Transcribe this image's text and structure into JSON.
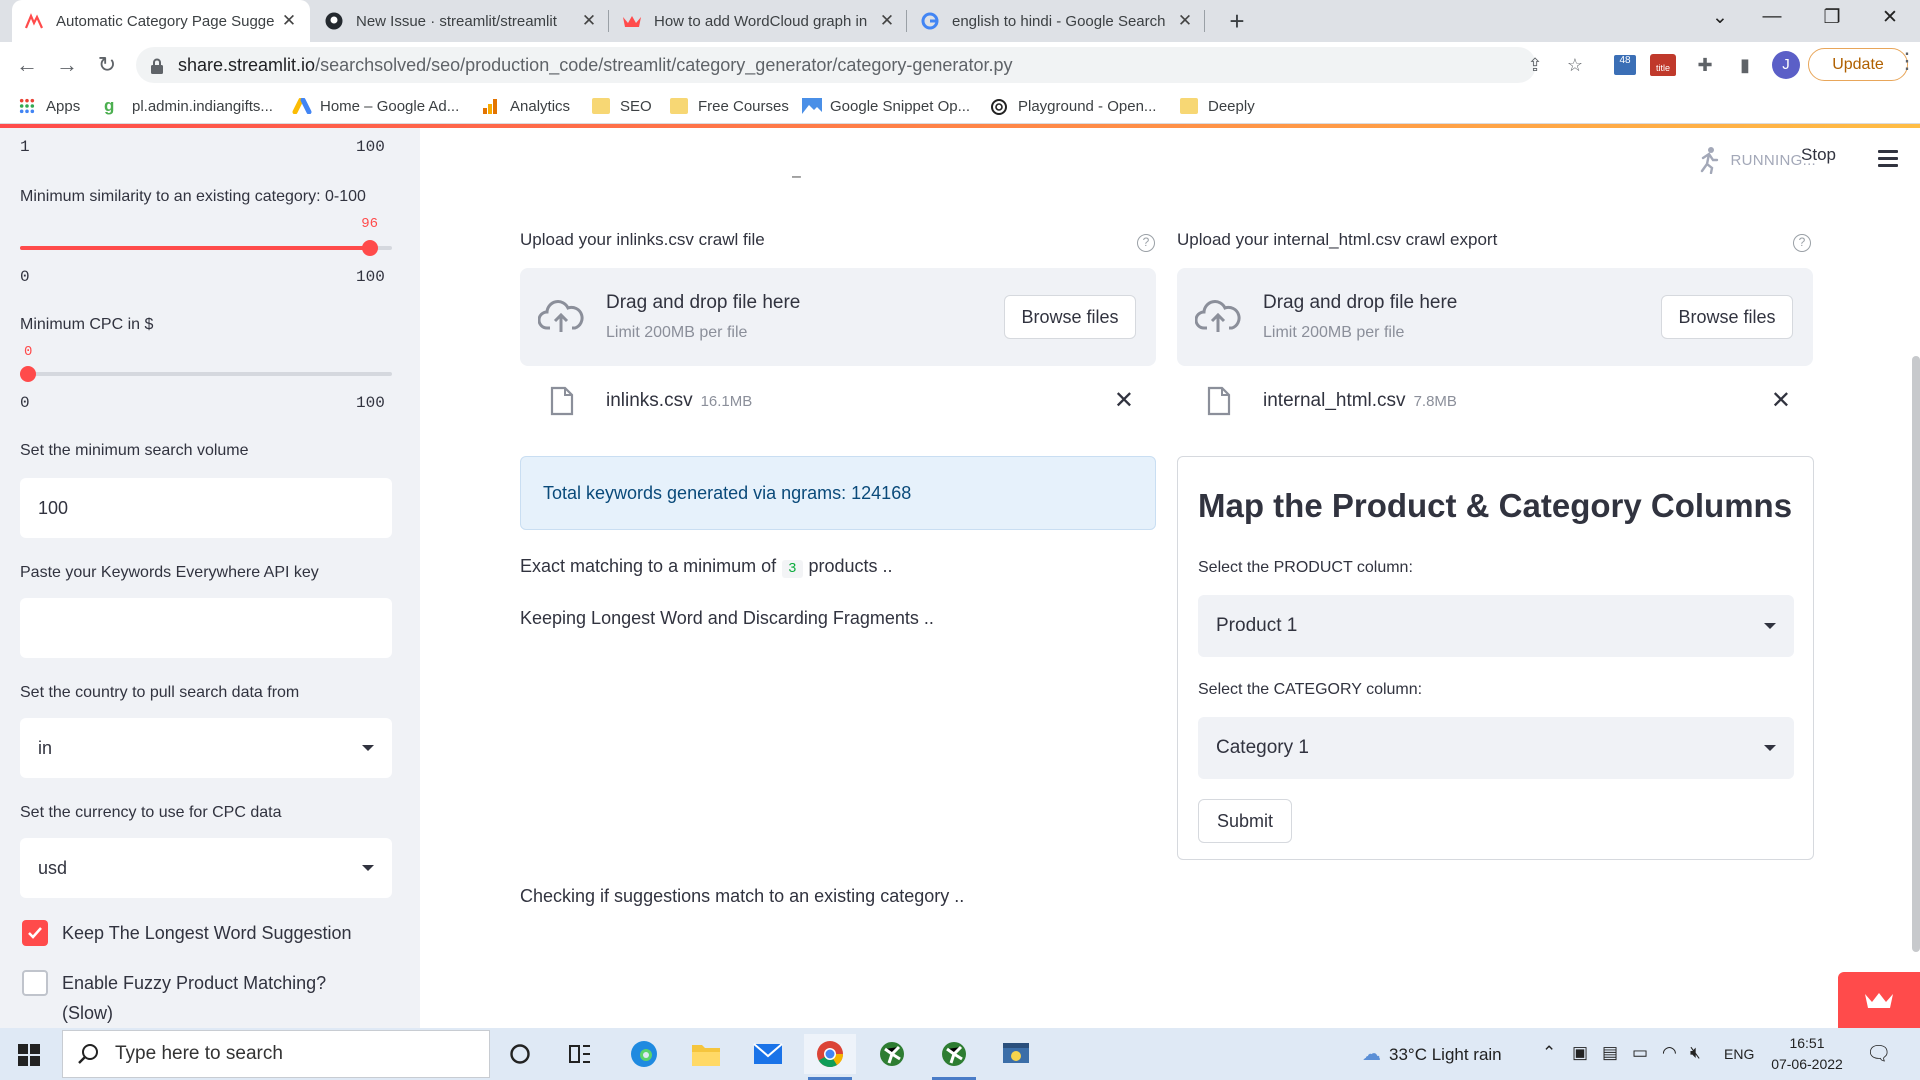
{
  "browser": {
    "tabs": [
      {
        "title": "Automatic Category Page Sugge",
        "icon": "streamlit-favicon"
      },
      {
        "title": "New Issue · streamlit/streamlit",
        "icon": "github-favicon"
      },
      {
        "title": "How to add WordCloud graph in",
        "icon": "streamlit-crown-favicon"
      },
      {
        "title": "english to hindi - Google Search",
        "icon": "google-favicon"
      }
    ],
    "url_domain": "share.streamlit.io",
    "url_path": "/searchsolved/seo/production_code/streamlit/category_generator/category-generator.py",
    "ext_badge": "48",
    "ext_title_badge": "title",
    "avatar": "J",
    "update_label": "Update",
    "bookmarks": [
      {
        "label": "Apps",
        "icon": "apps-grid-icon"
      },
      {
        "label": "pl.admin.indiangifts...",
        "icon": "g-icon"
      },
      {
        "label": "Home – Google Ad...",
        "icon": "google-ads-icon"
      },
      {
        "label": "Analytics",
        "icon": "analytics-icon"
      },
      {
        "label": "SEO",
        "icon": "folder-icon"
      },
      {
        "label": "Free Courses",
        "icon": "folder-icon"
      },
      {
        "label": "Google Snippet Op...",
        "icon": "image-icon"
      },
      {
        "label": "Playground - Open...",
        "icon": "openai-icon"
      },
      {
        "label": "Deeply",
        "icon": "folder-icon"
      }
    ]
  },
  "sidebar": {
    "slider0": {
      "min": "1",
      "max": "100"
    },
    "similarity": {
      "label": "Minimum similarity to an existing category: 0-100",
      "value": "96",
      "value_num": 96,
      "min": "0",
      "max": "100"
    },
    "cpc": {
      "label": "Minimum CPC in $",
      "value": "0",
      "value_num": 0,
      "min": "0",
      "max": "100"
    },
    "search_volume": {
      "label": "Set the minimum search volume",
      "value": "100"
    },
    "api_key": {
      "label": "Paste your Keywords Everywhere API key",
      "value": ""
    },
    "country": {
      "label": "Set the country to pull search data from",
      "value": "in"
    },
    "currency": {
      "label": "Set the currency to use for CPC data",
      "value": "usd"
    },
    "longest_word": {
      "label": "Keep The Longest Word Suggestion",
      "checked": true
    },
    "fuzzy": {
      "label": "Enable Fuzzy Product Matching?",
      "label2": "(Slow)",
      "checked": false
    }
  },
  "main": {
    "status": "RUNNING...",
    "stop_label": "Stop",
    "dash": "–",
    "upload_left": {
      "label": "Upload your inlinks.csv crawl file",
      "drag_text": "Drag and drop file here",
      "limit": "Limit 200MB per file",
      "browse": "Browse files",
      "file_name": "inlinks.csv",
      "file_size": "16.1MB"
    },
    "upload_right": {
      "label": "Upload your internal_html.csv crawl export",
      "drag_text": "Drag and drop file here",
      "limit": "Limit 200MB per file",
      "browse": "Browse files",
      "file_name": "internal_html.csv",
      "file_size": "7.8MB"
    },
    "info": "Total keywords generated via ngrams: 124168",
    "exact_pre": "Exact matching to a minimum of",
    "exact_num": "3",
    "exact_post": "products ..",
    "keeping": "Keeping Longest Word and Discarding Fragments ..",
    "checking": "Checking if suggestions match to an existing category ..",
    "form": {
      "title": "Map the Product & Category Columns",
      "product_label": "Select the PRODUCT column:",
      "product_value": "Product 1",
      "category_label": "Select the CATEGORY column:",
      "category_value": "Category 1",
      "submit": "Submit"
    }
  },
  "taskbar": {
    "search_placeholder": "Type here to search",
    "weather": "33°C  Light rain",
    "lang": "ENG",
    "time": "16:51",
    "date": "07-06-2022"
  },
  "colors": {
    "accent": "#ff4b4b",
    "info_bg": "#e6f1fb",
    "sidebar_bg": "#f0f2f6"
  }
}
